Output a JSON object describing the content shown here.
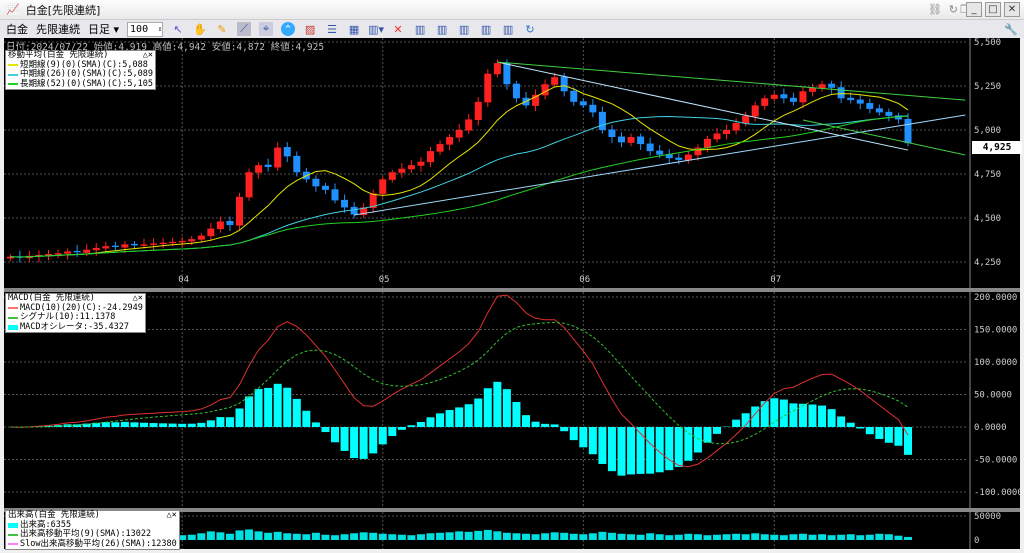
{
  "window": {
    "title": "白金[先限連続]"
  },
  "toolbar": {
    "symbol": "白金",
    "contract": "先限連続",
    "period": "日足",
    "count": "100"
  },
  "ohlc_bar": "日付:2024/07/22 始値:4,919 高値:4,942 安値:4,872 終値:4,925",
  "price_panel": {
    "legend_title": "移動平均(白金 先限連続)",
    "ma": [
      {
        "label": "短期線(9)(0)(SMA)(C):5,088",
        "period": 9,
        "color": "#e6e600"
      },
      {
        "label": "中期線(26)(0)(SMA)(C):5,089",
        "period": 26,
        "color": "#40d0e0"
      },
      {
        "label": "長期線(52)(0)(SMA)(C):5,105",
        "period": 52,
        "color": "#20d020"
      }
    ],
    "axis_labels": [
      "5,500",
      "5,250",
      "5,000",
      "4,750",
      "4,500",
      "4,250"
    ],
    "last_price": "4,925",
    "month_labels": [
      "04",
      "05",
      "06",
      "07"
    ]
  },
  "macd_panel": {
    "legend_title": "MACD(白金 先限連続)",
    "items": [
      {
        "label": "MACD(10)(20)(C):-24.2949",
        "color": "#ff6060"
      },
      {
        "label": "シグナル(10):11.1378",
        "color": "#40c040"
      },
      {
        "label": "MACDオシレータ:-35.4327",
        "color": "#00ffff"
      }
    ],
    "axis_labels": [
      "200.0000",
      "150.0000",
      "100.0000",
      "50.0000",
      "0.0000",
      "-50.0000",
      "-100.0000"
    ]
  },
  "volume_panel": {
    "legend_title": "出来高(白金 先限連続)",
    "items": [
      {
        "label": "出来高:6355",
        "color": "#00ffff"
      },
      {
        "label": "出来高移動平均(9)(SMA):13022",
        "color": "#40c040"
      },
      {
        "label": "Slow出来高移動平均(26)(SMA):12380",
        "color": "#ff80ff"
      }
    ],
    "axis_labels": [
      "50000",
      "0"
    ]
  },
  "chart_data": {
    "type": "candlestick",
    "price_range": [
      4160,
      5530
    ],
    "closes": [
      4280,
      4275,
      4285,
      4290,
      4295,
      4300,
      4310,
      4305,
      4320,
      4330,
      4340,
      4335,
      4350,
      4345,
      4350,
      4355,
      4360,
      4365,
      4370,
      4380,
      4400,
      4440,
      4480,
      4460,
      4620,
      4760,
      4800,
      4790,
      4900,
      4850,
      4760,
      4720,
      4680,
      4660,
      4600,
      4560,
      4520,
      4560,
      4640,
      4720,
      4760,
      4780,
      4800,
      4820,
      4880,
      4920,
      4960,
      5000,
      5060,
      5160,
      5320,
      5380,
      5260,
      5180,
      5140,
      5200,
      5260,
      5300,
      5220,
      5160,
      5140,
      5100,
      5000,
      4960,
      4930,
      4960,
      4920,
      4880,
      4860,
      4840,
      4830,
      4860,
      4900,
      4950,
      4980,
      5000,
      5040,
      5080,
      5140,
      5180,
      5200,
      5180,
      5160,
      5220,
      5240,
      5260,
      5240,
      5180,
      5170,
      5150,
      5120,
      5100,
      5080,
      5060,
      4925
    ],
    "volumes": [
      9000,
      11000,
      8000,
      10000,
      12000,
      9000,
      8000,
      10000,
      11000,
      9000,
      12000,
      10000,
      9000,
      8000,
      11000,
      10000,
      9000,
      12000,
      10000,
      11000,
      14000,
      18000,
      16000,
      13000,
      20000,
      22000,
      18000,
      15000,
      17000,
      14000,
      13000,
      12000,
      15000,
      11000,
      10000,
      12000,
      14000,
      16000,
      15000,
      13000,
      12000,
      11000,
      10000,
      12000,
      14000,
      15000,
      16000,
      18000,
      17000,
      19000,
      21000,
      18000,
      15000,
      14000,
      13000,
      12000,
      14000,
      16000,
      15000,
      13000,
      12000,
      14000,
      17000,
      15000,
      13000,
      12000,
      11000,
      14000,
      12000,
      10000,
      11000,
      13000,
      12000,
      10000,
      11000,
      12000,
      13000,
      12000,
      14000,
      12000,
      11000,
      10000,
      12000,
      13000,
      11000,
      12000,
      10000,
      11000,
      12000,
      10000,
      11000,
      13000,
      12000,
      9000,
      6355
    ],
    "trendlines": [
      {
        "from": [
          51,
          5386
        ],
        "to": [
          94,
          4886
        ],
        "color": "#c0e8ff"
      },
      {
        "from": [
          51,
          5386
        ],
        "to": [
          100,
          5170
        ],
        "color": "#40d040"
      },
      {
        "from": [
          36,
          4517
        ],
        "to": [
          100,
          5085
        ],
        "color": "#a0d8ff"
      },
      {
        "from": [
          83,
          5057
        ],
        "to": [
          100,
          4858
        ],
        "color": "#40d040"
      }
    ],
    "month_start_index": [
      18,
      39,
      60,
      80
    ],
    "macd": {
      "fast": 10,
      "slow": 20,
      "signal": 10,
      "range": [
        -120,
        205
      ]
    }
  }
}
